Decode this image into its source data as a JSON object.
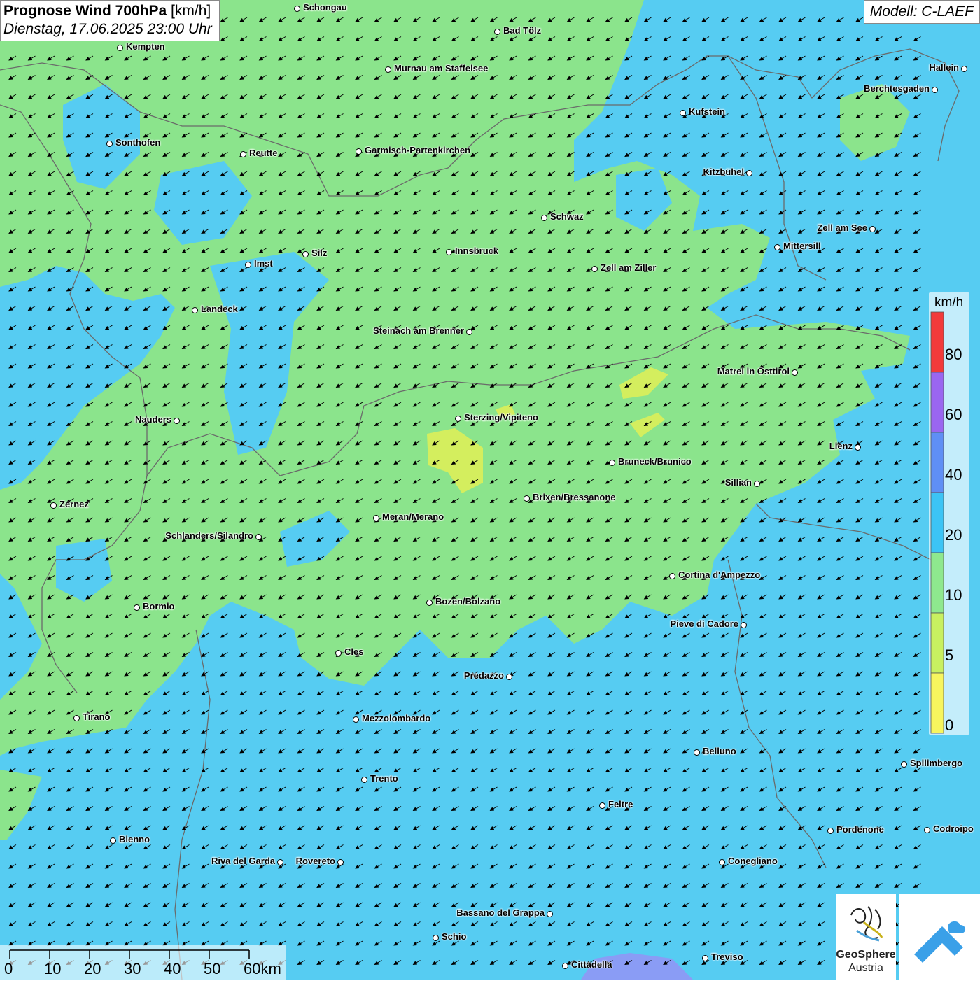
{
  "title": {
    "main": "Prognose Wind 700hPa",
    "unit": "[km/h]",
    "datetime": "Dienstag, 17.06.2025 23:00 Uhr"
  },
  "model": "Modell: C-LAEF",
  "legend": {
    "unit": "km/h",
    "labels": [
      "80",
      "60",
      "40",
      "20",
      "10",
      "5",
      "0"
    ],
    "colors": [
      "#f23a3a",
      "#9a66f0",
      "#5f8ff5",
      "#3cc4f5",
      "#8ee88e",
      "#c8f060",
      "#f7f55e"
    ]
  },
  "wind_arrow_direction": "south-west",
  "cities": [
    {
      "name": "Schongau"
    },
    {
      "name": "Bad Tölz"
    },
    {
      "name": "Kempten"
    },
    {
      "name": "Murnau am Staffelsee"
    },
    {
      "name": "Hallein"
    },
    {
      "name": "Berchtesgaden"
    },
    {
      "name": "Kufstein"
    },
    {
      "name": "Sonthofen"
    },
    {
      "name": "Reutte"
    },
    {
      "name": "Garmisch-Partenkirchen"
    },
    {
      "name": "Kitzbühel"
    },
    {
      "name": "Schwaz"
    },
    {
      "name": "Zell am See"
    },
    {
      "name": "Mittersill"
    },
    {
      "name": "Silz"
    },
    {
      "name": "Innsbruck"
    },
    {
      "name": "Imst"
    },
    {
      "name": "Zell am Ziller"
    },
    {
      "name": "Landeck"
    },
    {
      "name": "Steinach am Brenner"
    },
    {
      "name": "Matrei in Osttirol"
    },
    {
      "name": "Nauders"
    },
    {
      "name": "Sterzing/Vipiteno"
    },
    {
      "name": "Lienz"
    },
    {
      "name": "Bruneck/Brunico"
    },
    {
      "name": "Sillian"
    },
    {
      "name": "Brixen/Bressanone"
    },
    {
      "name": "Zernez"
    },
    {
      "name": "Meran/Merano"
    },
    {
      "name": "Schlanders/Silandro"
    },
    {
      "name": "Cortina d'Ampezzo"
    },
    {
      "name": "Bozen/Bolzano"
    },
    {
      "name": "Bormio"
    },
    {
      "name": "Pieve di Cadore"
    },
    {
      "name": "Cles"
    },
    {
      "name": "Predazzo"
    },
    {
      "name": "Tirano"
    },
    {
      "name": "Mezzolombardo"
    },
    {
      "name": "Belluno"
    },
    {
      "name": "Spilimbergo"
    },
    {
      "name": "Trento"
    },
    {
      "name": "Feltre"
    },
    {
      "name": "Pordenone"
    },
    {
      "name": "Codroipo"
    },
    {
      "name": "Bienno"
    },
    {
      "name": "Riva del Garda"
    },
    {
      "name": "Rovereto"
    },
    {
      "name": "Conegliano"
    },
    {
      "name": "Bassano del Grappa"
    },
    {
      "name": "Schio"
    },
    {
      "name": "Treviso"
    },
    {
      "name": "Cittadella"
    }
  ],
  "scale_bar": {
    "labels": [
      "0",
      "10",
      "20",
      "30",
      "40",
      "50",
      "60km"
    ]
  },
  "logo": {
    "org": "GeoSphere",
    "org2": "Austria"
  }
}
